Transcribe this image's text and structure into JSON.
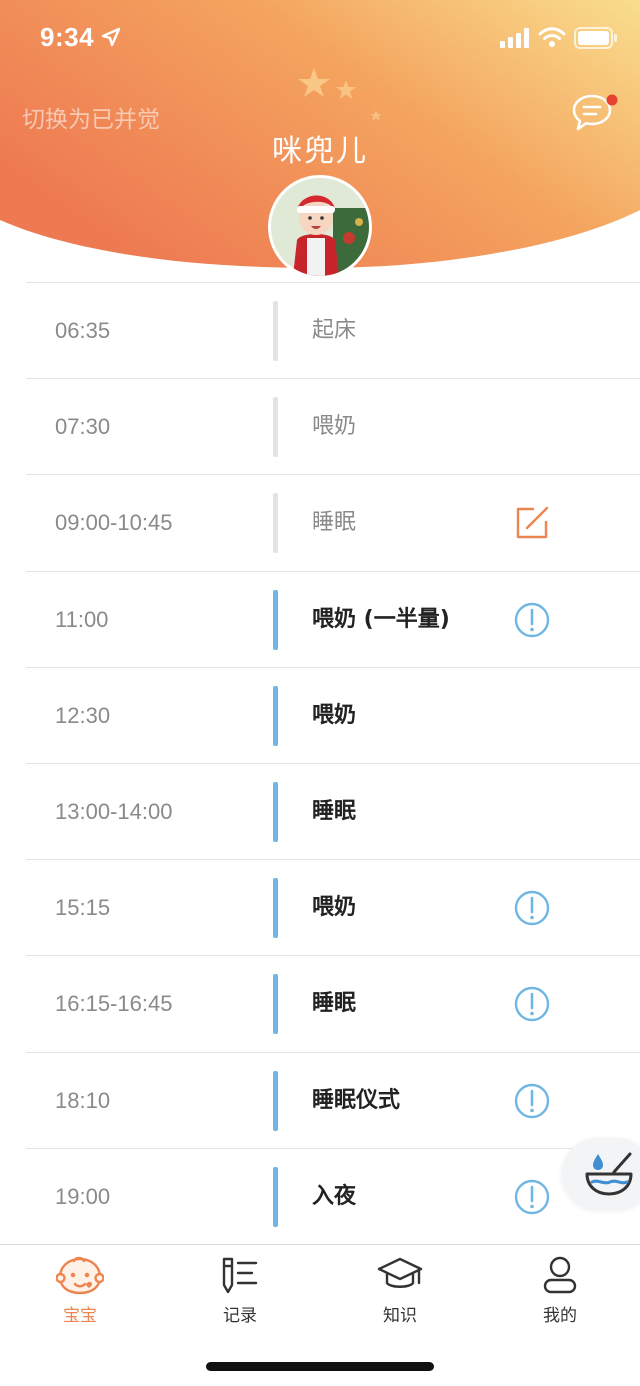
{
  "status_bar": {
    "time": "9:34"
  },
  "header": {
    "switch_label": "切换为已并觉",
    "baby_name": "咪兜儿"
  },
  "colors": {
    "header_gradient_start": "#ee7a52",
    "header_gradient_end": "#f8dc8c",
    "accent": "#ec8552",
    "active_bar": "#6fb6e4",
    "info_icon": "#6fb6e4"
  },
  "schedule": [
    {
      "time": "06:35",
      "activity": "起床",
      "status": "done",
      "action_icon": ""
    },
    {
      "time": "07:30",
      "activity": "喂奶",
      "status": "done",
      "action_icon": ""
    },
    {
      "time": "09:00-10:45",
      "activity": "睡眠",
      "status": "done",
      "action_icon": "edit-icon"
    },
    {
      "time": "11:00",
      "activity": "喂奶 (一半量)",
      "status": "upcoming",
      "action_icon": "info-icon"
    },
    {
      "time": "12:30",
      "activity": "喂奶",
      "status": "upcoming",
      "action_icon": ""
    },
    {
      "time": "13:00-14:00",
      "activity": "睡眠",
      "status": "upcoming",
      "action_icon": ""
    },
    {
      "time": "15:15",
      "activity": "喂奶",
      "status": "upcoming",
      "action_icon": "info-icon"
    },
    {
      "time": "16:15-16:45",
      "activity": "睡眠",
      "status": "upcoming",
      "action_icon": "info-icon"
    },
    {
      "time": "18:10",
      "activity": "睡眠仪式",
      "status": "upcoming",
      "action_icon": "info-icon"
    },
    {
      "time": "19:00",
      "activity": "入夜",
      "status": "upcoming",
      "action_icon": "info-icon"
    }
  ],
  "tabs": [
    {
      "label": "宝宝",
      "icon": "baby-face-icon",
      "selected": true
    },
    {
      "label": "记录",
      "icon": "record-list-icon",
      "selected": false
    },
    {
      "label": "知识",
      "icon": "graduation-cap-icon",
      "selected": false
    },
    {
      "label": "我的",
      "icon": "person-icon",
      "selected": false
    }
  ]
}
